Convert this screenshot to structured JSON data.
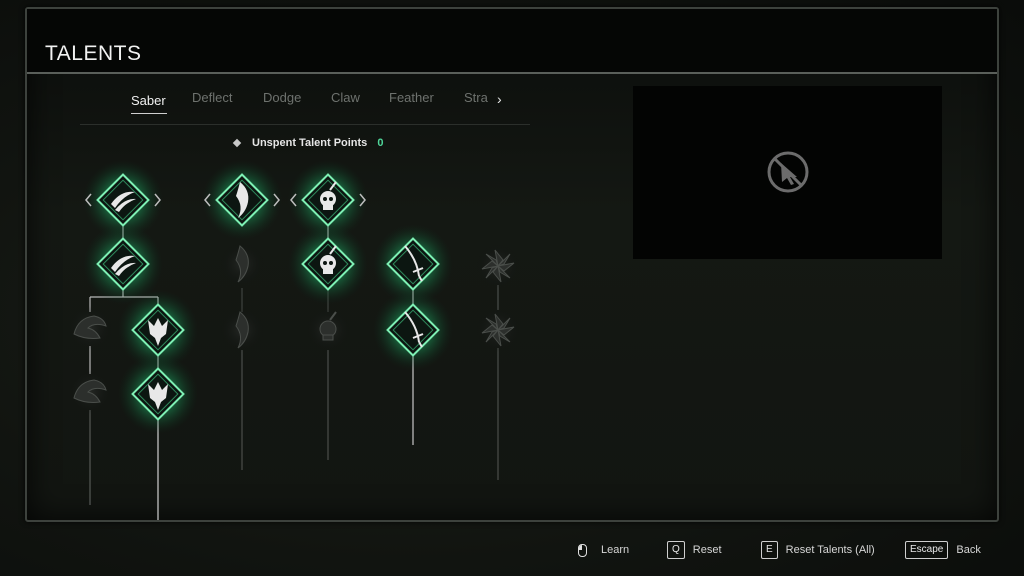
{
  "header": {
    "title": "TALENTS"
  },
  "tabs": [
    {
      "label": "Saber",
      "active": true
    },
    {
      "label": "Deflect",
      "active": false
    },
    {
      "label": "Dodge",
      "active": false
    },
    {
      "label": "Claw",
      "active": false
    },
    {
      "label": "Feather",
      "active": false
    },
    {
      "label": "Stra",
      "active": false
    }
  ],
  "tab_next_icon": "chevron-right-icon",
  "points": {
    "label": "Unspent Talent Points",
    "value": "0"
  },
  "preview": {
    "icon": "no-cursor-icon"
  },
  "talents": [
    {
      "id": "saber-claw-1",
      "icon": "claw-slash-icon",
      "active": true,
      "selector": true
    },
    {
      "id": "saber-claw-2",
      "icon": "claw-slash-icon",
      "active": true,
      "selector": false
    },
    {
      "id": "saber-horn-1",
      "icon": "horn-icon",
      "active": false,
      "selector": false
    },
    {
      "id": "saber-horn-2",
      "icon": "horn-icon",
      "active": false,
      "selector": false
    },
    {
      "id": "saber-helm-1",
      "icon": "helmet-icon",
      "active": true,
      "selector": false
    },
    {
      "id": "saber-helm-2",
      "icon": "helmet-icon",
      "active": true,
      "selector": false
    },
    {
      "id": "saber-blade-1",
      "icon": "blade-icon",
      "active": true,
      "selector": true
    },
    {
      "id": "saber-blade-2",
      "icon": "blade-icon",
      "active": false,
      "selector": false
    },
    {
      "id": "saber-blade-3",
      "icon": "blade-icon",
      "active": false,
      "selector": false
    },
    {
      "id": "saber-skull-1",
      "icon": "skull-icon",
      "active": true,
      "selector": true
    },
    {
      "id": "saber-skull-2",
      "icon": "skull-icon",
      "active": true,
      "selector": false
    },
    {
      "id": "saber-skull-3",
      "icon": "skull-icon",
      "active": false,
      "selector": false
    },
    {
      "id": "saber-sword-1",
      "icon": "sword-icon",
      "active": true,
      "selector": false
    },
    {
      "id": "saber-sword-2",
      "icon": "sword-icon",
      "active": true,
      "selector": false
    },
    {
      "id": "saber-pinwheel-1",
      "icon": "pinwheel-icon",
      "active": false,
      "selector": false
    },
    {
      "id": "saber-pinwheel-2",
      "icon": "pinwheel-icon",
      "active": false,
      "selector": false
    }
  ],
  "footer": {
    "learn_label": "Learn",
    "reset_key": "Q",
    "reset_label": "Reset",
    "reset_all_key": "E",
    "reset_all_label": "Reset Talents (All)",
    "back_key": "Escape",
    "back_label": "Back"
  },
  "colors": {
    "accent_glow": "#3fe08a",
    "points_value": "#4fd69a"
  }
}
